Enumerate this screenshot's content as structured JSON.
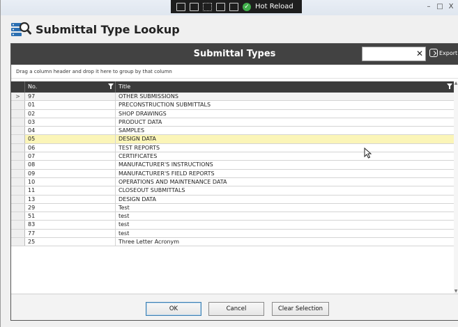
{
  "debug_toolbar": {
    "hot_reload_label": "Hot Reload"
  },
  "window_controls": {
    "minimize": "–",
    "maximize": "□",
    "close": "X"
  },
  "dialog": {
    "title": "Submittal Type Lookup",
    "icon": "database-search-icon"
  },
  "panel": {
    "title": "Submittal Types",
    "search_value": "",
    "search_clear": "✕",
    "export_label": "Export",
    "group_hint": "Drag a column header and drop it here to group by that column"
  },
  "grid": {
    "columns": [
      {
        "label": "No."
      },
      {
        "label": "Title"
      }
    ],
    "current_row_marker": ">",
    "rows": [
      {
        "no": "97",
        "title": "OTHER SUBMISSIONS",
        "state": "current"
      },
      {
        "no": "01",
        "title": "PRECONSTRUCTION SUBMITTALS",
        "state": ""
      },
      {
        "no": "02",
        "title": "SHOP DRAWINGS",
        "state": ""
      },
      {
        "no": "03",
        "title": "PRODUCT DATA",
        "state": ""
      },
      {
        "no": "04",
        "title": "SAMPLES",
        "state": ""
      },
      {
        "no": "05",
        "title": "DESIGN DATA",
        "state": "hover"
      },
      {
        "no": "06",
        "title": "TEST REPORTS",
        "state": ""
      },
      {
        "no": "07",
        "title": "CERTIFICATES",
        "state": ""
      },
      {
        "no": "08",
        "title": "MANUFACTURER'S INSTRUCTIONS",
        "state": ""
      },
      {
        "no": "09",
        "title": "MANUFACTURER'S FIELD REPORTS",
        "state": ""
      },
      {
        "no": "10",
        "title": "OPERATIONS AND MAINTENANCE DATA",
        "state": ""
      },
      {
        "no": "11",
        "title": "CLOSEOUT SUBMITTALS",
        "state": ""
      },
      {
        "no": "13",
        "title": "DESIGN DATA",
        "state": ""
      },
      {
        "no": "29",
        "title": "Test",
        "state": ""
      },
      {
        "no": "51",
        "title": "test",
        "state": ""
      },
      {
        "no": "83",
        "title": "test",
        "state": ""
      },
      {
        "no": "77",
        "title": "test",
        "state": ""
      },
      {
        "no": "25",
        "title": "Three Letter Acronym",
        "state": ""
      }
    ]
  },
  "footer": {
    "ok_label": "OK",
    "cancel_label": "Cancel",
    "clear_label": "Clear Selection"
  },
  "colors": {
    "header_bar": "#424242",
    "grid_header": "#3b3b3b",
    "hover_row": "#fbf5b8",
    "hot_reload_ok": "#3fae4a"
  }
}
